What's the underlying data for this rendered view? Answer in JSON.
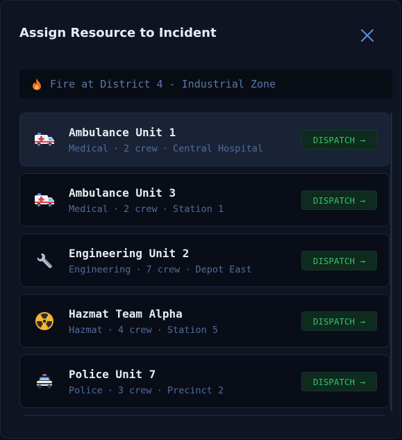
{
  "modal": {
    "title": "Assign Resource to Incident",
    "close_icon": "close-icon"
  },
  "incident": {
    "icon": "fire-icon",
    "text": "Fire at District 4 - Industrial Zone"
  },
  "resources": [
    {
      "name": "Ambulance Unit 1",
      "type": "Medical",
      "crew": "2 crew",
      "location": "Central Hospital",
      "icon": "ambulance-icon",
      "action": "DISPATCH →",
      "selected": true
    },
    {
      "name": "Ambulance Unit 3",
      "type": "Medical",
      "crew": "2 crew",
      "location": "Station 1",
      "icon": "ambulance-icon",
      "action": "DISPATCH →",
      "selected": false
    },
    {
      "name": "Engineering Unit 2",
      "type": "Engineering",
      "crew": "7 crew",
      "location": "Depot East",
      "icon": "wrench-icon",
      "action": "DISPATCH →",
      "selected": false
    },
    {
      "name": "Hazmat Team Alpha",
      "type": "Hazmat",
      "crew": "4 crew",
      "location": "Station 5",
      "icon": "radioactive-icon",
      "action": "DISPATCH →",
      "selected": false
    },
    {
      "name": "Police Unit 7",
      "type": "Police",
      "crew": "3 crew",
      "location": "Precinct 2",
      "icon": "police-car-icon",
      "action": "DISPATCH →",
      "selected": false
    }
  ],
  "separator": "·",
  "colors": {
    "background": "#0e1422",
    "accent_green": "#32c46a",
    "meta_blue": "#4f6d9e",
    "close_blue": "#5b8fd9"
  }
}
